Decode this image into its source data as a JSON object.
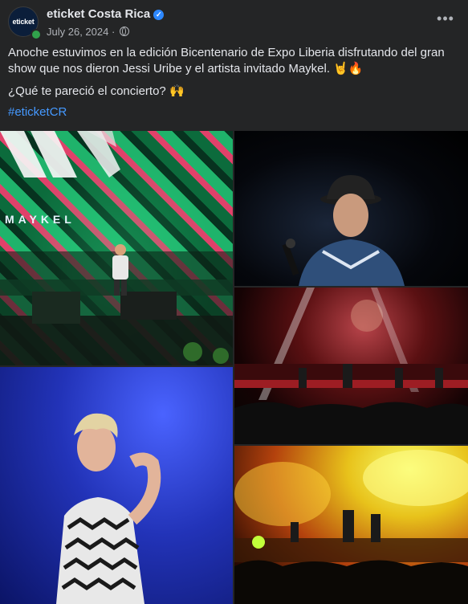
{
  "post": {
    "author": "eticket Costa Rica",
    "avatar_text": "eticket",
    "date": "July 26, 2024",
    "audience_icon": "globe-icon",
    "more_icon": "more-horizontal-icon",
    "verified_icon": "verified-badge-icon",
    "paragraph_1": "Anoche estuvimos en la edición Bicentenario de Expo Liberia disfrutando del gran show que nos dieron Jessi Uribe y el artista invitado Maykel. 🤘🔥",
    "paragraph_2": "¿Qué te pareció el concierto? 🙌",
    "hashtag": "#eticketCR"
  },
  "photos": {
    "photo1_caption": "MAYKEL"
  },
  "colors": {
    "background": "#242526",
    "text": "#e4e6eb",
    "secondary_text": "#b0b3b8",
    "link": "#4599ff",
    "verified": "#2d88ff",
    "online": "#31a24c"
  }
}
